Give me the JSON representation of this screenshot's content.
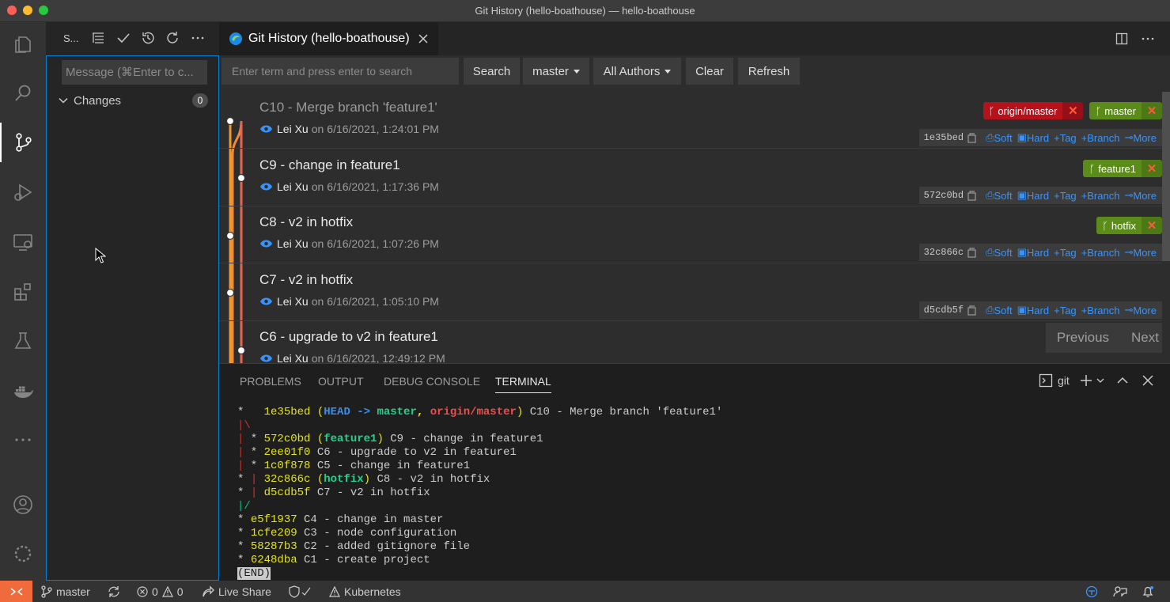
{
  "window": {
    "title": "Git History (hello-boathouse) — hello-boathouse"
  },
  "sidebar": {
    "title": "S...",
    "message_placeholder": "Message (⌘Enter to c...",
    "changes_label": "Changes",
    "changes_count": "0"
  },
  "editor": {
    "tab_label": "Git History (hello-boathouse)",
    "toolbar": {
      "search_placeholder": "Enter term and press enter to search",
      "search_label": "Search",
      "branch_label": "master",
      "authors_label": "All Authors",
      "clear_label": "Clear",
      "refresh_label": "Refresh"
    },
    "action_labels": {
      "soft": "Soft",
      "hard": "Hard",
      "tag": "Tag",
      "branch": "Branch",
      "more": "More"
    },
    "on_word": "on",
    "commits": [
      {
        "title": "C10 - Merge branch 'feature1'",
        "author": "Lei Xu",
        "date": "6/16/2021, 1:24:01 PM",
        "hash": "1e35bed",
        "refs": [
          {
            "name": "origin/master",
            "kind": "remote"
          },
          {
            "name": "master",
            "kind": "local"
          }
        ]
      },
      {
        "title": "C9 - change in feature1",
        "author": "Lei Xu",
        "date": "6/16/2021, 1:17:36 PM",
        "hash": "572c0bd",
        "refs": [
          {
            "name": "feature1",
            "kind": "local"
          }
        ]
      },
      {
        "title": "C8 - v2 in hotfix",
        "author": "Lei Xu",
        "date": "6/16/2021, 1:07:26 PM",
        "hash": "32c866c",
        "refs": [
          {
            "name": "hotfix",
            "kind": "local"
          }
        ]
      },
      {
        "title": "C7 - v2 in hotfix",
        "author": "Lei Xu",
        "date": "6/16/2021, 1:05:10 PM",
        "hash": "d5cdb5f",
        "refs": []
      },
      {
        "title": "C6 - upgrade to v2 in feature1",
        "author": "Lei Xu",
        "date": "6/16/2021, 12:49:12 PM",
        "hash": "",
        "refs": []
      }
    ],
    "pager": {
      "previous": "Previous",
      "next": "Next"
    }
  },
  "panel": {
    "tabs": [
      "PROBLEMS",
      "OUTPUT",
      "DEBUG CONSOLE",
      "TERMINAL"
    ],
    "active_tab": "TERMINAL",
    "terminal_name": "git",
    "log": [
      {
        "graph": "*   ",
        "hash": "1e35bed",
        "refs": [
          {
            "t": "HEAD -> ",
            "c": "b"
          },
          {
            "t": "master",
            "c": "c"
          },
          {
            "t": ", ",
            "c": "y"
          },
          {
            "t": "origin/master",
            "c": "r"
          }
        ],
        "msg": "C10 - Merge branch 'feature1'"
      },
      {
        "graph": "|\\",
        "graph_color": "bar-r"
      },
      {
        "graph": "| * ",
        "graph_color": "bar-r",
        "hash": "572c0bd",
        "refs": [
          {
            "t": "feature1",
            "c": "c"
          }
        ],
        "msg": "C9 - change in feature1"
      },
      {
        "graph": "| * ",
        "graph_color": "bar-r",
        "hash": "2ee01f0",
        "msg": "C6 - upgrade to v2 in feature1"
      },
      {
        "graph": "| * ",
        "graph_color": "bar-r",
        "hash": "1c0f878",
        "msg": "C5 - change in feature1"
      },
      {
        "graph": "* | ",
        "graph_color": "bar-r",
        "hash": "32c866c",
        "refs": [
          {
            "t": "hotfix",
            "c": "c"
          }
        ],
        "msg": "C8 - v2 in hotfix"
      },
      {
        "graph": "* | ",
        "graph_color": "bar-r",
        "hash": "d5cdb5f",
        "msg": "C7 - v2 in hotfix"
      },
      {
        "graph": "|/",
        "graph_color": "bar-g"
      },
      {
        "graph": "* ",
        "hash": "e5f1937",
        "msg": "C4 - change in master"
      },
      {
        "graph": "* ",
        "hash": "1cfe209",
        "msg": "C3 - node configuration"
      },
      {
        "graph": "* ",
        "hash": "58287b3",
        "msg": "C2 - added gitignore file"
      },
      {
        "graph": "* ",
        "hash": "6248dba",
        "msg": "C1 - create project"
      },
      {
        "end": "(END)"
      }
    ]
  },
  "statusbar": {
    "branch": "master",
    "errors": "0",
    "warnings": "0",
    "live_share": "Live Share",
    "kubernetes": "Kubernetes"
  },
  "colors": {
    "accent": "#007fd4",
    "remote_ref": "#b5121b",
    "local_ref": "#5b8c1a",
    "link": "#3794ff",
    "remote_indicator": "#f06a3b"
  }
}
